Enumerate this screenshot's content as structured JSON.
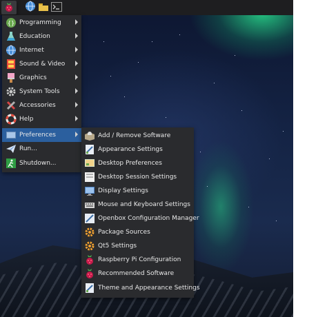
{
  "taskbar": {
    "buttons": [
      "raspberry-menu-icon",
      "web-browser-icon",
      "file-manager-icon",
      "terminal-icon"
    ]
  },
  "main_menu": {
    "items": [
      {
        "label": "Programming",
        "icon": "programming-icon",
        "submenu": true
      },
      {
        "label": "Education",
        "icon": "education-icon",
        "submenu": true
      },
      {
        "label": "Internet",
        "icon": "internet-globe-icon",
        "submenu": true
      },
      {
        "label": "Sound & Video",
        "icon": "sound-video-icon",
        "submenu": true
      },
      {
        "label": "Graphics",
        "icon": "graphics-icon",
        "submenu": true
      },
      {
        "label": "System Tools",
        "icon": "gear-icon",
        "submenu": true
      },
      {
        "label": "Accessories",
        "icon": "accessories-icon",
        "submenu": true
      },
      {
        "label": "Help",
        "icon": "lifebuoy-icon",
        "submenu": true
      },
      {
        "label": "Preferences",
        "icon": "preferences-icon",
        "submenu": true,
        "active": true
      },
      {
        "label": "Run...",
        "icon": "run-icon",
        "submenu": false
      },
      {
        "label": "Shutdown...",
        "icon": "shutdown-icon",
        "submenu": false
      }
    ]
  },
  "preferences_menu": {
    "items": [
      {
        "label": "Add / Remove Software",
        "icon": "package-box-icon"
      },
      {
        "label": "Appearance Settings",
        "icon": "appearance-icon"
      },
      {
        "label": "Desktop Preferences",
        "icon": "desktop-icon"
      },
      {
        "label": "Desktop Session Settings",
        "icon": "session-icon"
      },
      {
        "label": "Display Settings",
        "icon": "monitor-icon"
      },
      {
        "label": "Mouse and Keyboard Settings",
        "icon": "keyboard-icon"
      },
      {
        "label": "Openbox Configuration Manager",
        "icon": "openbox-icon"
      },
      {
        "label": "Package Sources",
        "icon": "package-sources-icon"
      },
      {
        "label": "Qt5 Settings",
        "icon": "qt-settings-icon"
      },
      {
        "label": "Raspberry Pi Configuration",
        "icon": "raspberry-icon"
      },
      {
        "label": "Recommended Software",
        "icon": "raspberry-icon"
      },
      {
        "label": "Theme and Appearance Settings",
        "icon": "theme-icon"
      }
    ]
  },
  "colors": {
    "menu_bg": "#2a2b2e",
    "highlight": "#2b5f9e",
    "taskbar_bg": "#1e1e20",
    "menu_text": "#e8e8e8"
  }
}
